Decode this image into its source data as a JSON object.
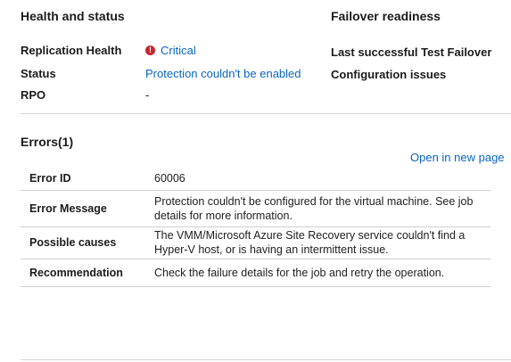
{
  "health": {
    "title": "Health and status",
    "replication_health_label": "Replication Health",
    "replication_health_value": "Critical",
    "replication_health_icon": "error-circle-icon",
    "status_label": "Status",
    "status_value": "Protection couldn't be enabled",
    "rpo_label": "RPO",
    "rpo_value": "-"
  },
  "failover": {
    "title": "Failover readiness",
    "last_test_label": "Last successful Test Failover",
    "config_issues_label": "Configuration issues"
  },
  "errors": {
    "title": "Errors(1)",
    "open_link": "Open in new page",
    "rows": [
      {
        "key": "Error ID",
        "value": "60006"
      },
      {
        "key": "Error Message",
        "value": "Protection couldn't be configured for the virtual machine. See job details for more information."
      },
      {
        "key": "Possible causes",
        "value": "The VMM/Microsoft Azure Site Recovery service couldn't find a Hyper-V host, or is having an intermittent issue."
      },
      {
        "key": "Recommendation",
        "value": "Check the failure details for the job and retry the operation."
      }
    ]
  },
  "colors": {
    "link": "#0a66c2",
    "critical": "#c4262e",
    "divider": "#d6d6d6"
  }
}
